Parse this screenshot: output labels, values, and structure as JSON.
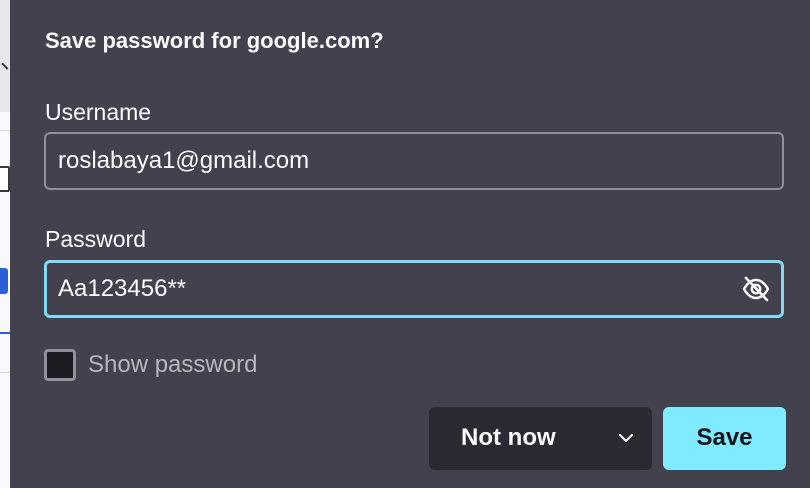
{
  "dialog": {
    "title": "Save password for google.com?",
    "username_label": "Username",
    "username_value": "roslabaya1@gmail.com",
    "password_label": "Password",
    "password_value": "Aa123456**",
    "reveal_icon": "eye-slash-icon",
    "show_password_label": "Show password",
    "show_password_checked": false,
    "not_now_label": "Not now",
    "not_now_dropdown_icon": "chevron-down-icon",
    "save_label": "Save"
  },
  "colors": {
    "panel_bg": "#42414d",
    "focus_border": "#7fdcf7",
    "primary_button": "#80ebff",
    "secondary_button": "#2b2a33",
    "text": "#fbfbfe"
  }
}
